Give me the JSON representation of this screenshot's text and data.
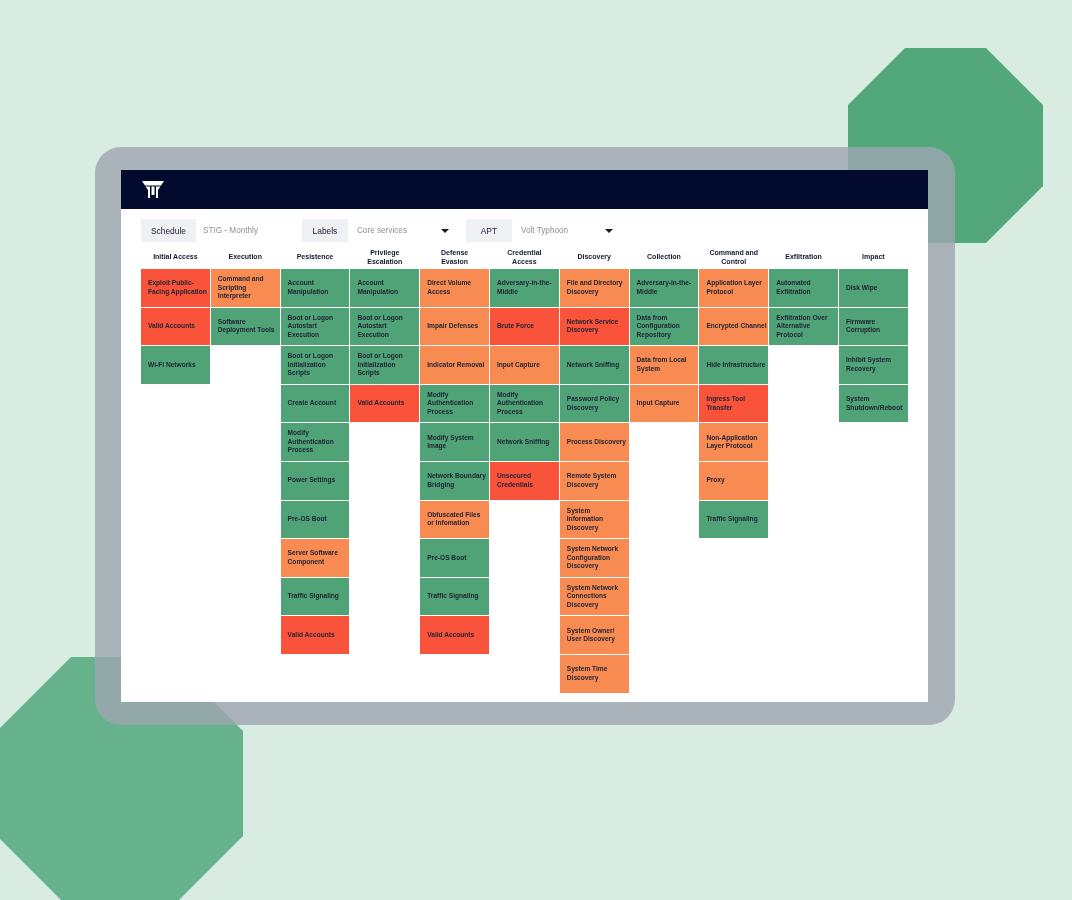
{
  "filters": [
    {
      "label": "Schedule",
      "value": "STIG - Monthly",
      "kind": "static"
    },
    {
      "label": "Labels",
      "value": "Core services",
      "kind": "dropdown"
    },
    {
      "label": "APT",
      "value": "Volt Typhoon",
      "kind": "dropdown"
    }
  ],
  "matrix": {
    "columns": [
      {
        "title": "Initial Access",
        "techniques": [
          {
            "name": "Exploit Public-Facing Application",
            "color": "#f9543b"
          },
          {
            "name": "Valid Accounts",
            "color": "#f9543b"
          },
          {
            "name": "Wi-Fi Networks",
            "color": "#4fa377"
          }
        ]
      },
      {
        "title": "Execution",
        "techniques": [
          {
            "name": "Command and Scripting Interpreter",
            "color": "#f78b52"
          },
          {
            "name": "Software Deployment Tools",
            "color": "#4fa377"
          }
        ]
      },
      {
        "title": "Pesistence",
        "techniques": [
          {
            "name": "Account Manipulation",
            "color": "#4fa377"
          },
          {
            "name": "Boot or Logon Autostart Execution",
            "color": "#4fa377"
          },
          {
            "name": "Boot or Logon Initialization Scripts",
            "color": "#4fa377"
          },
          {
            "name": "Create Account",
            "color": "#4fa377"
          },
          {
            "name": "Modify Authentication Process",
            "color": "#4fa377"
          },
          {
            "name": "Power Settings",
            "color": "#4fa377"
          },
          {
            "name": "Pre-OS Boot",
            "color": "#4fa377"
          },
          {
            "name": "Server Software Component",
            "color": "#f78b52"
          },
          {
            "name": "Traffic Signaling",
            "color": "#4fa377"
          },
          {
            "name": "Valid Accounts",
            "color": "#f9543b"
          }
        ]
      },
      {
        "title": "Privilege Escalation",
        "techniques": [
          {
            "name": "Account Manipulation",
            "color": "#4fa377"
          },
          {
            "name": "Boot or Logon Autostart Execution",
            "color": "#4fa377"
          },
          {
            "name": "Boot or Logon Initialization Scripts",
            "color": "#4fa377"
          },
          {
            "name": "Valid Accounts",
            "color": "#f9543b"
          }
        ]
      },
      {
        "title": "Defense Evasion",
        "techniques": [
          {
            "name": "Direct Volume Access",
            "color": "#f78b52"
          },
          {
            "name": "Impair Defenses",
            "color": "#f78b52"
          },
          {
            "name": "Indicator Removal",
            "color": "#f78b52"
          },
          {
            "name": "Modify Authentication Process",
            "color": "#4fa377"
          },
          {
            "name": "Modify System Image",
            "color": "#4fa377"
          },
          {
            "name": "Network Boundary Bridging",
            "color": "#4fa377"
          },
          {
            "name": "Obfuscated Files or Infomation",
            "color": "#f78b52"
          },
          {
            "name": "Pre-OS Boot",
            "color": "#4fa377"
          },
          {
            "name": "Traffic Signaling",
            "color": "#4fa377"
          },
          {
            "name": "Valid Accounts",
            "color": "#f9543b"
          }
        ]
      },
      {
        "title": "Credential Access",
        "techniques": [
          {
            "name": "Adversary-in-the-Middle",
            "color": "#4fa377"
          },
          {
            "name": "Brute Force",
            "color": "#f9543b"
          },
          {
            "name": "Input Capture",
            "color": "#f78b52"
          },
          {
            "name": "Modify Authentication Process",
            "color": "#4fa377"
          },
          {
            "name": "Network Sniffing",
            "color": "#4fa377"
          },
          {
            "name": "Unsecured Credentials",
            "color": "#f9543b"
          }
        ]
      },
      {
        "title": "Discovery",
        "techniques": [
          {
            "name": "File and Directory Discovery",
            "color": "#f78b52"
          },
          {
            "name": "Network Service Discovery",
            "color": "#f9543b"
          },
          {
            "name": "Network Sniffing",
            "color": "#4fa377"
          },
          {
            "name": "Password Policy Discovery",
            "color": "#4fa377"
          },
          {
            "name": "Process Discovery",
            "color": "#f78b52"
          },
          {
            "name": "Remote System Discovery",
            "color": "#f78b52"
          },
          {
            "name": "System Information Discovery",
            "color": "#f78b52"
          },
          {
            "name": "System Network Configuration Discovery",
            "color": "#f78b52"
          },
          {
            "name": "System Network Connections Discovery",
            "color": "#f78b52"
          },
          {
            "name": "System Owner/ User Discovery",
            "color": "#f78b52"
          },
          {
            "name": "System Time Discovery",
            "color": "#f78b52"
          }
        ]
      },
      {
        "title": "Collection",
        "techniques": [
          {
            "name": "Adversary-in-the-Middle",
            "color": "#4fa377"
          },
          {
            "name": "Data from Configuration Repository",
            "color": "#4fa377"
          },
          {
            "name": "Data from Local System",
            "color": "#f78b52"
          },
          {
            "name": "Input Capture",
            "color": "#f78b52"
          }
        ]
      },
      {
        "title": "Command and Control",
        "techniques": [
          {
            "name": "Application Layer Protocol",
            "color": "#f78b52"
          },
          {
            "name": "Encrypted Channel",
            "color": "#f78b52"
          },
          {
            "name": "Hide Infrastructure",
            "color": "#4fa377"
          },
          {
            "name": "Ingress Tool Transfer",
            "color": "#f9543b"
          },
          {
            "name": "Non-Application Layer Protocol",
            "color": "#f78b52"
          },
          {
            "name": "Proxy",
            "color": "#f78b52"
          },
          {
            "name": "Traffic Signaling",
            "color": "#4fa377"
          }
        ]
      },
      {
        "title": "Exfiltration",
        "techniques": [
          {
            "name": "Automated Exfiltration",
            "color": "#4fa377"
          },
          {
            "name": "Exfiltration Over Alternative Protocol",
            "color": "#4fa377"
          }
        ]
      },
      {
        "title": "Impact",
        "techniques": [
          {
            "name": "Disk Wipe",
            "color": "#4fa377"
          },
          {
            "name": "Firmware Corruption",
            "color": "#4fa377"
          },
          {
            "name": "Inhibit System Recovery",
            "color": "#4fa377"
          },
          {
            "name": "System Shutdown/Reboot",
            "color": "#4fa377"
          }
        ]
      }
    ]
  }
}
